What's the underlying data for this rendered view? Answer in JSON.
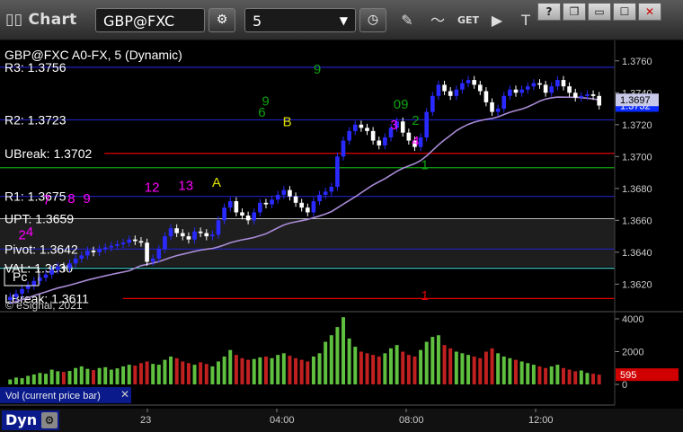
{
  "toolbar": {
    "title": "Chart",
    "symbol": "GBP@FXC",
    "interval": "5"
  },
  "chart_title": "GBP@FXC A0-FX, 5 (Dynamic)",
  "copyright": "© eSignal, 2021",
  "volume_label": "Vol (current price bar)",
  "bottom_label": "Dyn",
  "lc_label": "Pc",
  "colors": {
    "up": "#2a2aff",
    "down": "#ffffff",
    "ma": "#a98bd6",
    "resistance": "#2020c0",
    "support_red": "#e00000",
    "green": "#10a010",
    "magenta": "#ff00ff",
    "cyan": "#40c0c0"
  },
  "levels": [
    {
      "label": "R3: 1.3756",
      "value": 1.3756,
      "color": "#2020c0",
      "x_start": 0
    },
    {
      "label": "R2: 1.3723",
      "value": 1.3723,
      "color": "#2020c0",
      "x_start": 0
    },
    {
      "label": "UBreak: 1.3702",
      "value": 1.3702,
      "color": "#e00000",
      "x_start": 0.17
    },
    {
      "label": "",
      "value": 1.3693,
      "color": "#10a010",
      "x_start": 0
    },
    {
      "label": "R1: 1.3675",
      "value": 1.3675,
      "color": "#2020c0",
      "x_start": 0
    },
    {
      "label": "UPT: 1.3659",
      "value": 1.3661,
      "color": "#c0c0c0",
      "x_start": 0
    },
    {
      "label": "Pivot: 1.3642",
      "value": 1.3642,
      "color": "#2020c0",
      "x_start": 0
    },
    {
      "label": "VAL: 1.3630",
      "value": 1.363,
      "color": "#40c0c0",
      "x_start": 0
    },
    {
      "label": "LBreak: 1.3611",
      "value": 1.3611,
      "color": "#e00000",
      "x_start": 0.2
    }
  ],
  "chart_data": [
    {
      "type": "candlestick",
      "title": "GBP@FXC A0-FX, 5 (Dynamic)",
      "ylim": [
        1.3605,
        1.377
      ],
      "y_ticks": [
        1.362,
        1.364,
        1.366,
        1.368,
        1.37,
        1.372,
        1.374,
        1.376
      ],
      "y_tick_labels": [
        "1.3620",
        "1.3640",
        "1.3660",
        "1.3680",
        "1.3700",
        "1.3720",
        "1.3740",
        "1.3760"
      ],
      "x_ticks": [
        "23",
        "04:00",
        "08:00",
        "12:00"
      ],
      "last_price": "1.3732",
      "ma_value": "1.3697",
      "close": [
        1.3612,
        1.3614,
        1.3617,
        1.3619,
        1.3622,
        1.3624,
        1.3626,
        1.3629,
        1.3631,
        1.363,
        1.3633,
        1.3636,
        1.3638,
        1.3641,
        1.364,
        1.3642,
        1.3643,
        1.3644,
        1.3645,
        1.3646,
        1.3648,
        1.3647,
        1.3646,
        1.3634,
        1.3636,
        1.3642,
        1.365,
        1.3655,
        1.3652,
        1.365,
        1.3648,
        1.3653,
        1.3652,
        1.365,
        1.3651,
        1.366,
        1.3668,
        1.3672,
        1.3665,
        1.3663,
        1.366,
        1.3665,
        1.3671,
        1.367,
        1.3673,
        1.3676,
        1.3679,
        1.3675,
        1.3671,
        1.3668,
        1.3665,
        1.3672,
        1.3676,
        1.3678,
        1.3681,
        1.37,
        1.371,
        1.3716,
        1.372,
        1.3718,
        1.3716,
        1.371,
        1.3707,
        1.3712,
        1.3718,
        1.3722,
        1.3715,
        1.371,
        1.3706,
        1.3712,
        1.3728,
        1.3738,
        1.3745,
        1.3741,
        1.3738,
        1.3742,
        1.3746,
        1.3748,
        1.3745,
        1.3741,
        1.3734,
        1.3728,
        1.373,
        1.3738,
        1.3742,
        1.374,
        1.3742,
        1.3744,
        1.3746,
        1.3745,
        1.374,
        1.3744,
        1.3748,
        1.3744,
        1.374,
        1.3737,
        1.3738,
        1.3739,
        1.3738,
        1.3732
      ],
      "annotations": [
        {
          "text": "2",
          "color": "#ff00ff",
          "x": 0.03,
          "y": 1.3648
        },
        {
          "text": "4",
          "color": "#ff00ff",
          "x": 0.042,
          "y": 1.365
        },
        {
          "text": "7",
          "color": "#ff00ff",
          "x": 0.07,
          "y": 1.367
        },
        {
          "text": "8",
          "color": "#ff00ff",
          "x": 0.11,
          "y": 1.3671
        },
        {
          "text": "9",
          "color": "#ff00ff",
          "x": 0.135,
          "y": 1.3671
        },
        {
          "text": "12",
          "color": "#ff00ff",
          "x": 0.235,
          "y": 1.3678
        },
        {
          "text": "13",
          "color": "#ff00ff",
          "x": 0.29,
          "y": 1.3679
        },
        {
          "text": "A",
          "color": "#e0e000",
          "x": 0.345,
          "y": 1.3681
        },
        {
          "text": "B",
          "color": "#e0e000",
          "x": 0.46,
          "y": 1.3719
        },
        {
          "text": "9",
          "color": "#10a010",
          "x": 0.426,
          "y": 1.3732
        },
        {
          "text": "6",
          "color": "#10a010",
          "x": 0.42,
          "y": 1.3725
        },
        {
          "text": "9",
          "color": "#10a010",
          "x": 0.51,
          "y": 1.3752
        },
        {
          "text": "09",
          "color": "#10a010",
          "x": 0.64,
          "y": 1.373
        },
        {
          "text": "3",
          "color": "#ff00ff",
          "x": 0.635,
          "y": 1.3717
        },
        {
          "text": "4",
          "color": "#ff00ff",
          "x": 0.67,
          "y": 1.3707
        },
        {
          "text": "2",
          "color": "#10a010",
          "x": 0.67,
          "y": 1.372
        },
        {
          "text": "1",
          "color": "#10a010",
          "x": 0.685,
          "y": 1.3692
        },
        {
          "text": "1",
          "color": "#e00000",
          "x": 0.685,
          "y": 1.361
        }
      ]
    },
    {
      "type": "bar",
      "title": "Vol (current price bar)",
      "ylim": [
        0,
        4000
      ],
      "y_ticks": [
        0,
        2000,
        4000
      ],
      "y_tick_labels": [
        "0",
        "2000",
        "4000"
      ],
      "last_value": "595",
      "values": [
        300,
        420,
        380,
        520,
        610,
        700,
        650,
        900,
        800,
        760,
        820,
        1000,
        1100,
        950,
        870,
        1000,
        1050,
        900,
        980,
        1100,
        1200,
        1150,
        1300,
        1400,
        1250,
        1200,
        1500,
        1700,
        1600,
        1400,
        1300,
        1200,
        1350,
        1250,
        1100,
        1400,
        1700,
        2100,
        1800,
        1600,
        1500,
        1550,
        1650,
        1700,
        1600,
        1800,
        1900,
        1750,
        1600,
        1500,
        1400,
        1700,
        1900,
        2600,
        3000,
        3500,
        4100,
        2800,
        2300,
        2000,
        1900,
        1800,
        1700,
        1900,
        2200,
        2400,
        2000,
        1800,
        1700,
        2100,
        2600,
        2900,
        3000,
        2400,
        2200,
        2000,
        1900,
        1800,
        1700,
        1600,
        2000,
        2200,
        1900,
        1700,
        1600,
        1500,
        1400,
        1300,
        1200,
        1100,
        1000,
        1100,
        1200,
        1000,
        900,
        800,
        850,
        700,
        650,
        595
      ],
      "up": [
        1,
        1,
        1,
        1,
        1,
        1,
        1,
        1,
        1,
        0,
        1,
        1,
        1,
        1,
        0,
        1,
        1,
        1,
        1,
        1,
        1,
        0,
        0,
        0,
        1,
        1,
        1,
        1,
        0,
        0,
        0,
        1,
        0,
        0,
        1,
        1,
        1,
        1,
        0,
        0,
        0,
        1,
        1,
        0,
        1,
        1,
        1,
        0,
        0,
        0,
        0,
        1,
        1,
        1,
        1,
        1,
        1,
        1,
        1,
        0,
        0,
        0,
        0,
        1,
        1,
        1,
        0,
        0,
        0,
        1,
        1,
        1,
        1,
        0,
        0,
        1,
        1,
        1,
        0,
        0,
        0,
        0,
        1,
        1,
        1,
        0,
        1,
        1,
        1,
        0,
        0,
        1,
        1,
        0,
        0,
        0,
        1,
        1,
        0,
        0
      ]
    }
  ]
}
